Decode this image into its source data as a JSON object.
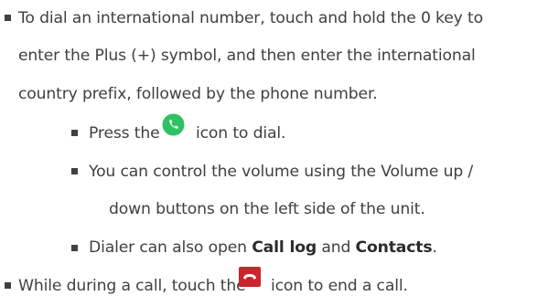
{
  "items": [
    {
      "lines": [
        "To dial an international number, touch and hold the 0 key to",
        "enter the Plus (+) symbol, and then enter the international",
        "country prefix, followed by the phone number."
      ]
    },
    {
      "before": "Press the",
      "icon": "dial-call-icon",
      "after": "icon to dial."
    },
    {
      "lines": [
        "You can control the volume using the Volume up /",
        "down buttons on the left side of the unit."
      ]
    },
    {
      "text_before": "Dialer can also open ",
      "link1": "Call log",
      "text_mid": " and ",
      "link2": "Contacts",
      "text_after": "."
    },
    {
      "before": "While during a call, touch the",
      "icon": "end-call-icon",
      "after": "icon to end a call."
    }
  ],
  "colors": {
    "text": "#404040",
    "dial_icon": "#2ec262",
    "end_icon": "#c9252b"
  }
}
